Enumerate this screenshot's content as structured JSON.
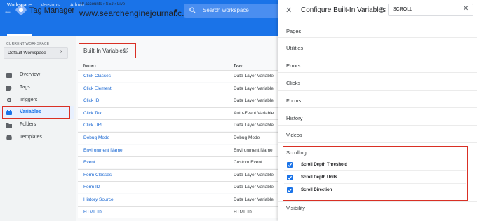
{
  "header": {
    "product": "Tag Manager",
    "crumb": "All accounts › SEJ › Live",
    "container": "www.searchenginejournal.c...",
    "search_placeholder": "Search workspace",
    "brand_color": "#1a73e8"
  },
  "tabs": [
    {
      "label": "Workspace",
      "active": true
    },
    {
      "label": "Versions",
      "active": false
    },
    {
      "label": "Admin",
      "active": false
    }
  ],
  "sidebar": {
    "workspace_label": "CURRENT WORKSPACE",
    "workspace_name": "Default Workspace",
    "items": [
      {
        "label": "Overview",
        "icon": "overview-icon"
      },
      {
        "label": "Tags",
        "icon": "tag-icon"
      },
      {
        "label": "Triggers",
        "icon": "trigger-icon"
      },
      {
        "label": "Variables",
        "icon": "variables-icon",
        "active": true
      },
      {
        "label": "Folders",
        "icon": "folder-icon"
      },
      {
        "label": "Templates",
        "icon": "template-icon"
      }
    ]
  },
  "main": {
    "card_title": "Built-In Variables",
    "columns": {
      "name": "Name ↑",
      "type": "Type"
    },
    "rows": [
      {
        "name": "Click Classes",
        "type": "Data Layer Variable"
      },
      {
        "name": "Click Element",
        "type": "Data Layer Variable"
      },
      {
        "name": "Click ID",
        "type": "Data Layer Variable"
      },
      {
        "name": "Click Text",
        "type": "Auto-Event Variable"
      },
      {
        "name": "Click URL",
        "type": "Data Layer Variable"
      },
      {
        "name": "Debug Mode",
        "type": "Debug Mode"
      },
      {
        "name": "Environment Name",
        "type": "Environment Name"
      },
      {
        "name": "Event",
        "type": "Custom Event"
      },
      {
        "name": "Form Classes",
        "type": "Data Layer Variable"
      },
      {
        "name": "Form ID",
        "type": "Data Layer Variable"
      },
      {
        "name": "History Source",
        "type": "Data Layer Variable"
      },
      {
        "name": "HTML ID",
        "type": "HTML ID"
      }
    ]
  },
  "panel": {
    "title": "Configure Built-In Variables",
    "search_value": "SCROLL",
    "categories": [
      "Pages",
      "Utilities",
      "Errors",
      "Clicks",
      "Forms",
      "History",
      "Videos"
    ],
    "scrolling": {
      "label": "Scrolling",
      "items": [
        {
          "label": "Scroll Depth Threshold",
          "checked": true
        },
        {
          "label": "Scroll Depth Units",
          "checked": true
        },
        {
          "label": "Scroll Direction",
          "checked": true
        }
      ]
    },
    "after": [
      "Visibility"
    ]
  }
}
